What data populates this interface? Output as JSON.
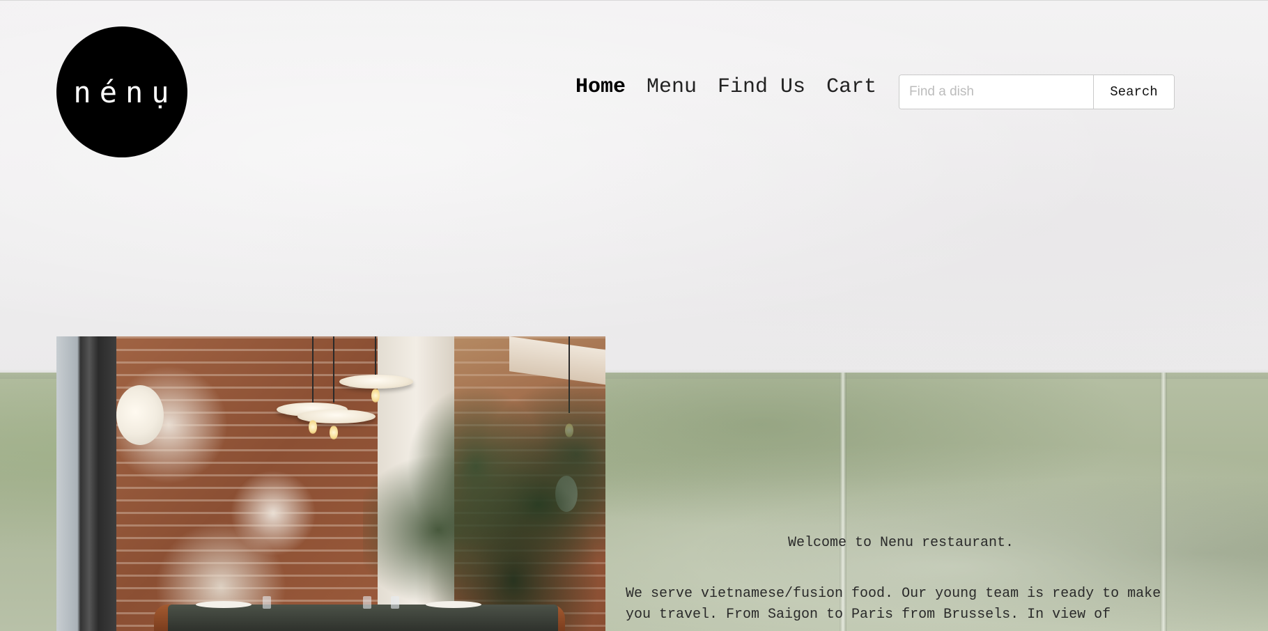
{
  "brand": {
    "logo_text": "nénụ"
  },
  "nav": {
    "items": [
      {
        "label": "Home",
        "active": true
      },
      {
        "label": "Menu",
        "active": false
      },
      {
        "label": "Find Us",
        "active": false
      },
      {
        "label": "Cart",
        "active": false
      }
    ]
  },
  "search": {
    "placeholder": "Find a dish",
    "value": "",
    "button_label": "Search"
  },
  "hero": {
    "image_subject": "restaurant interior with brick walls, pendant lamps and a palm plant"
  },
  "content": {
    "welcome": "Welcome to Nenu restaurant.",
    "intro": "We serve vietnamese/fusion food. Our young team is ready to make you travel. From Saigon to Paris from Brussels. In view of"
  },
  "colors": {
    "logo_bg": "#000000",
    "logo_text": "#ffffff",
    "wall": "#f0eff0",
    "bench": "#aab597",
    "text": "#2a2a2a"
  }
}
